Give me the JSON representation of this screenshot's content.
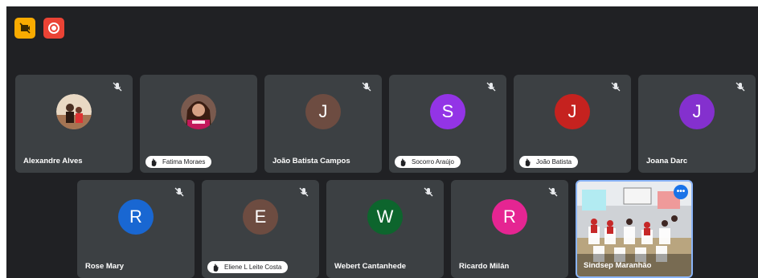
{
  "toolbar": {
    "left_icon": "present-icon",
    "right_icon": "record-icon",
    "left_color": "#f9ab00",
    "right_color": "#ea4335"
  },
  "participants": [
    {
      "name": "Alexandre Alves",
      "initial": "",
      "avatar_color": "#5f6368",
      "avatar_type": "photo",
      "muted": true,
      "hand_raised": false
    },
    {
      "name": "Fatima Moraes",
      "initial": "",
      "avatar_color": "#5f6368",
      "avatar_type": "photo",
      "muted": false,
      "hand_raised": true
    },
    {
      "name": "João Batista Campos",
      "initial": "J",
      "avatar_color": "#6d4c41",
      "avatar_type": "initial",
      "muted": true,
      "hand_raised": false
    },
    {
      "name": "Socorro Araújo",
      "initial": "S",
      "avatar_color": "#9334e6",
      "avatar_type": "initial",
      "muted": true,
      "hand_raised": true
    },
    {
      "name": "João Batista",
      "initial": "J",
      "avatar_color": "#c5221f",
      "avatar_type": "initial",
      "muted": true,
      "hand_raised": true
    },
    {
      "name": "Joana Darc",
      "initial": "J",
      "avatar_color": "#8430ce",
      "avatar_type": "initial",
      "muted": true,
      "hand_raised": false
    },
    {
      "name": "Rose Mary",
      "initial": "R",
      "avatar_color": "#1967d2",
      "avatar_type": "initial",
      "muted": true,
      "hand_raised": false
    },
    {
      "name": "Eliene L Leite Costa",
      "initial": "E",
      "avatar_color": "#6d4c41",
      "avatar_type": "initial",
      "muted": true,
      "hand_raised": true
    },
    {
      "name": "Webert Cantanhede",
      "initial": "W",
      "avatar_color": "#0d652d",
      "avatar_type": "initial",
      "muted": true,
      "hand_raised": false
    },
    {
      "name": "Ricardo Milán",
      "initial": "R",
      "avatar_color": "#e52592",
      "avatar_type": "initial",
      "muted": true,
      "hand_raised": false
    },
    {
      "name": "Sindsep Maranhão",
      "initial": "",
      "avatar_color": "#5f6368",
      "avatar_type": "video",
      "muted": false,
      "hand_raised": false,
      "more_label": "•••"
    }
  ]
}
